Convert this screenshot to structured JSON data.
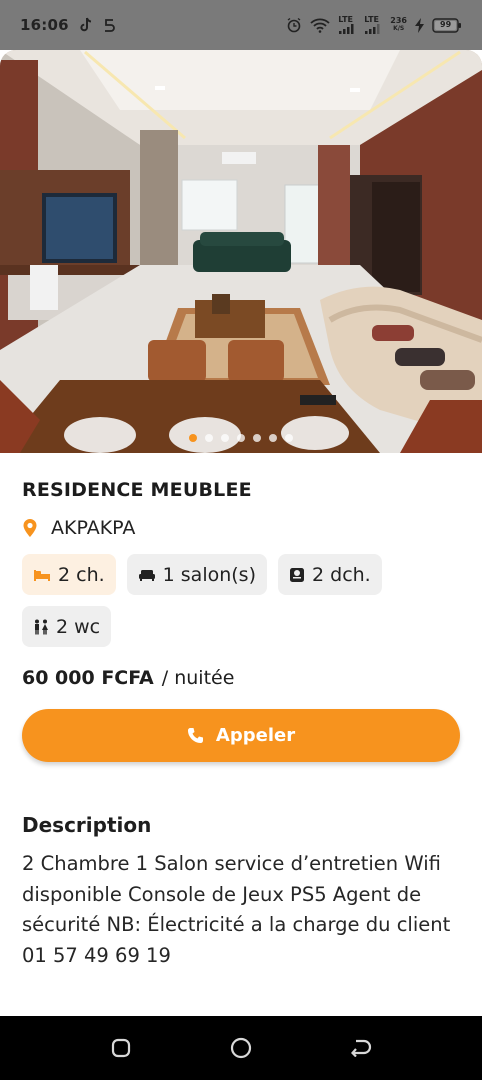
{
  "status_bar": {
    "time": "16:06",
    "lte1": "LTE",
    "lte2": "LTE",
    "speed": "236",
    "speed_unit": "K/S",
    "battery": "99"
  },
  "gallery": {
    "slide_count": 7,
    "active_index": 0
  },
  "listing": {
    "title": "RESIDENCE MEUBLEE",
    "location": "AKPAKPA",
    "features": [
      {
        "label": "2 ch.",
        "icon": "bed-icon"
      },
      {
        "label": "1 salon(s)",
        "icon": "sofa-icon"
      },
      {
        "label": "2 dch.",
        "icon": "shower-icon"
      },
      {
        "label": "2 wc",
        "icon": "restroom-icon"
      }
    ],
    "price": "60 000 FCFA",
    "price_unit": "/ nuitée",
    "call_label": "Appeler",
    "description_title": "Description",
    "description": "2 Chambre 1 Salon  service d’entretien Wifi disponible  Console de Jeux PS5 Agent de sécurité  NB: Électricité a la charge du client 01 57 49 69 19"
  },
  "colors": {
    "accent": "#f7931e",
    "chip_bg": "#efefef",
    "chip_highlight_bg": "#fdf0e1"
  }
}
